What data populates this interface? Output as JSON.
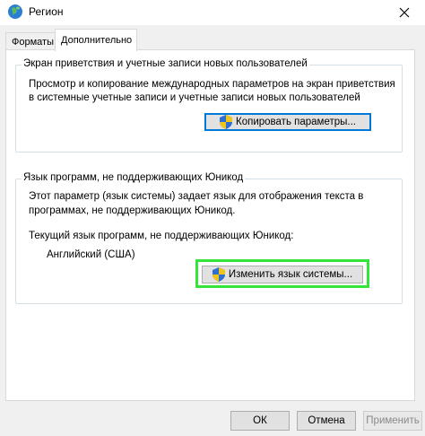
{
  "window": {
    "title": "Регион",
    "icon": "globe-icon"
  },
  "tabs": [
    {
      "label": "Форматы",
      "active": false
    },
    {
      "label": "Дополнительно",
      "active": true
    }
  ],
  "welcome_group": {
    "legend": "Экран приветствия и учетные записи новых пользователей",
    "desc_line1": "Просмотр и копирование международных параметров на экран приветствия",
    "desc_line2": "в системные учетные записи и учетные записи новых пользователей",
    "copy_button": "Копировать параметры..."
  },
  "unicode_group": {
    "legend": "Язык программ, не поддерживающих Юникод",
    "desc_line1": "Этот параметр (язык системы) задает язык для отображения текста в",
    "desc_line2": "программах, не поддерживающих Юникод.",
    "current_label": "Текущий язык программ, не поддерживающих Юникод:",
    "current_value": "Английский (США)",
    "change_button": "Изменить язык системы..."
  },
  "footer": {
    "ok": "ОК",
    "cancel": "Отмена",
    "apply": "Применить"
  },
  "colors": {
    "highlight": "#35e43a",
    "focus": "#0078d7"
  }
}
